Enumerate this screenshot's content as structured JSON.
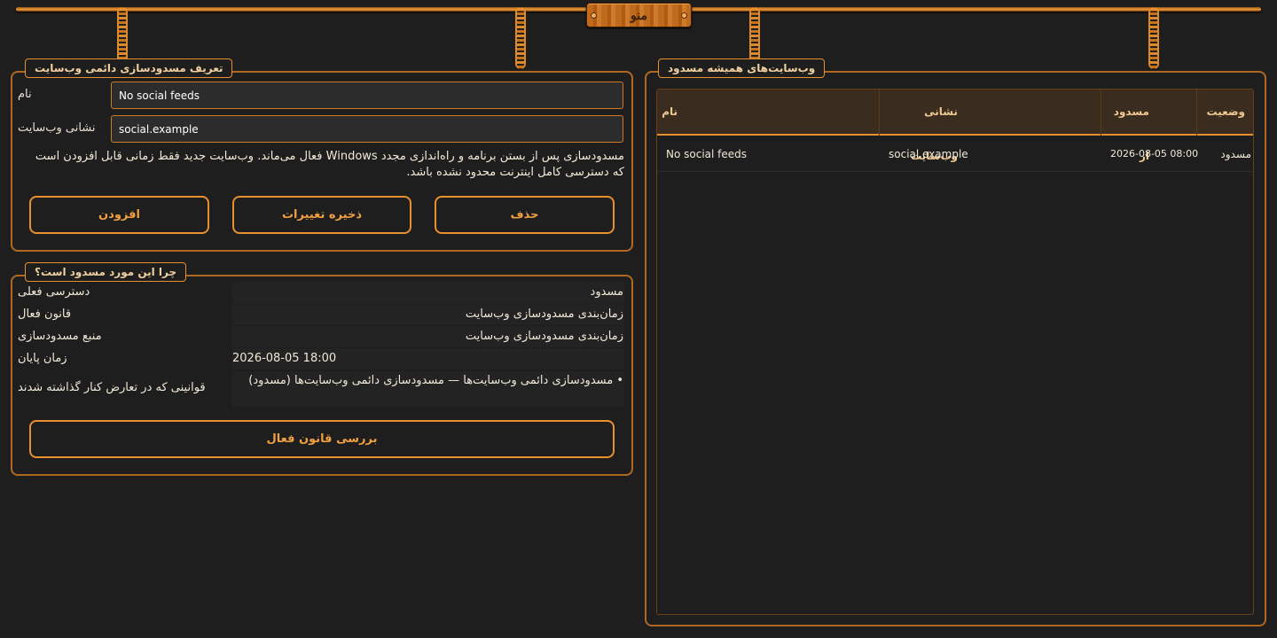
{
  "menu": {
    "label": "منو"
  },
  "definition": {
    "legend": "تعریف مسدودسازی دائمی وب‌سایت",
    "name_label": "نام",
    "name_value": "No social feeds",
    "address_label": "نشانی وب‌سایت",
    "address_value": "social.example",
    "note": "مسدودسازی پس از بستن برنامه و راه‌اندازی مجدد Windows فعال می‌ماند. وب‌سایت جدید فقط زمانی قابل افزودن است که دسترسی کامل اینترنت محدود نشده باشد.",
    "buttons": {
      "add": "افزودن",
      "save": "ذخیره تغییرات",
      "delete": "حذف"
    }
  },
  "why": {
    "legend": "چرا این مورد مسدود است؟",
    "rows": [
      {
        "label": "دسترسی فعلی",
        "value": "مسدود"
      },
      {
        "label": "قانون فعال",
        "value": "زمان‌بندی مسدودسازی وب‌سایت"
      },
      {
        "label": "منبع مسدودسازی",
        "value": "زمان‌بندی مسدودسازی وب‌سایت"
      },
      {
        "label": "زمان پایان",
        "value": "2026-08-05 18:00"
      },
      {
        "label": "قوانینی که در تعارض کنار گذاشته شدند",
        "value": "• مسدودسازی دائمی وب‌سایت‌ها — مسدودسازی دائمی وب‌سایت‌ها (مسدود)"
      }
    ],
    "review_button": "بررسی قانون فعال"
  },
  "blocked": {
    "legend": "وب‌سایت‌های همیشه مسدود",
    "columns": {
      "status": "وضعیت",
      "since": "مسدود از",
      "address": "نشانی وب‌سایت",
      "name": "نام"
    },
    "rows": [
      {
        "status": "مسدود",
        "since": "2026-08-05 08:00",
        "address": "social.example",
        "name": "No social feeds"
      }
    ]
  },
  "colors": {
    "accent": "#e89030",
    "background": "#1e1e1e"
  },
  "icons": [
    "chain-icon"
  ]
}
